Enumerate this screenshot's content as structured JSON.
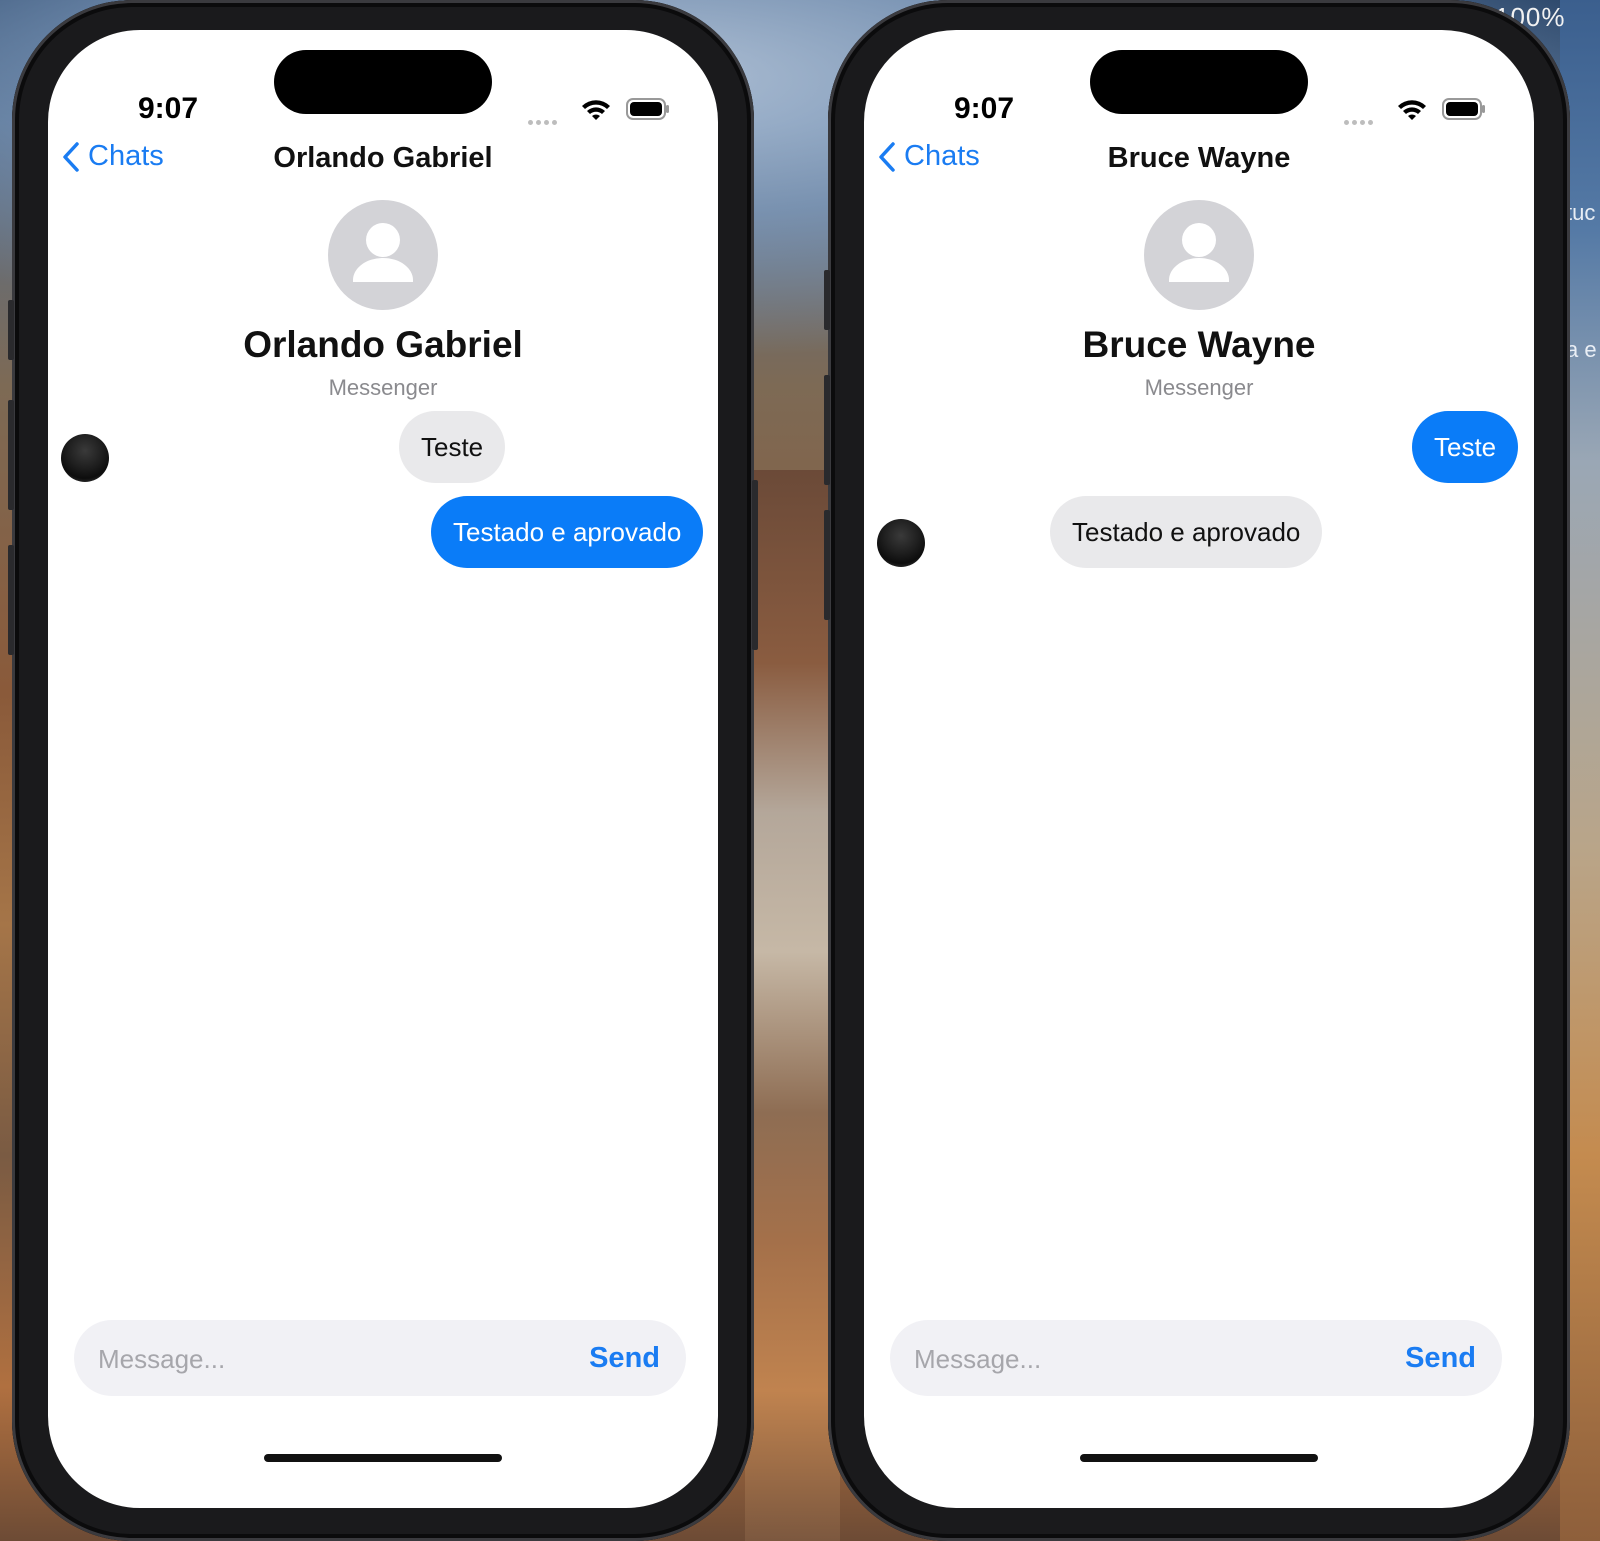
{
  "desktop": {
    "zoom_label": "100%",
    "peek_text_1": "tuc",
    "peek_text_2": "a e"
  },
  "phones": [
    {
      "status": {
        "time": "9:07"
      },
      "nav": {
        "back_label": "Chats",
        "title": "Orlando Gabriel"
      },
      "profile": {
        "name": "Orlando Gabriel",
        "subtitle": "Messenger"
      },
      "messages": [
        {
          "text": "Teste",
          "direction": "incoming"
        },
        {
          "text": "Testado e aprovado",
          "direction": "outgoing"
        }
      ],
      "composer": {
        "placeholder": "Message...",
        "send_label": "Send"
      }
    },
    {
      "status": {
        "time": "9:07"
      },
      "nav": {
        "back_label": "Chats",
        "title": "Bruce Wayne"
      },
      "profile": {
        "name": "Bruce Wayne",
        "subtitle": "Messenger"
      },
      "messages": [
        {
          "text": "Teste",
          "direction": "outgoing"
        },
        {
          "text": "Testado e aprovado",
          "direction": "incoming"
        }
      ],
      "composer": {
        "placeholder": "Message...",
        "send_label": "Send"
      }
    }
  ],
  "colors": {
    "accent": "#1a7cf2",
    "outgoing_bubble": "#0a7cf8",
    "incoming_bubble": "#e9e9eb"
  }
}
